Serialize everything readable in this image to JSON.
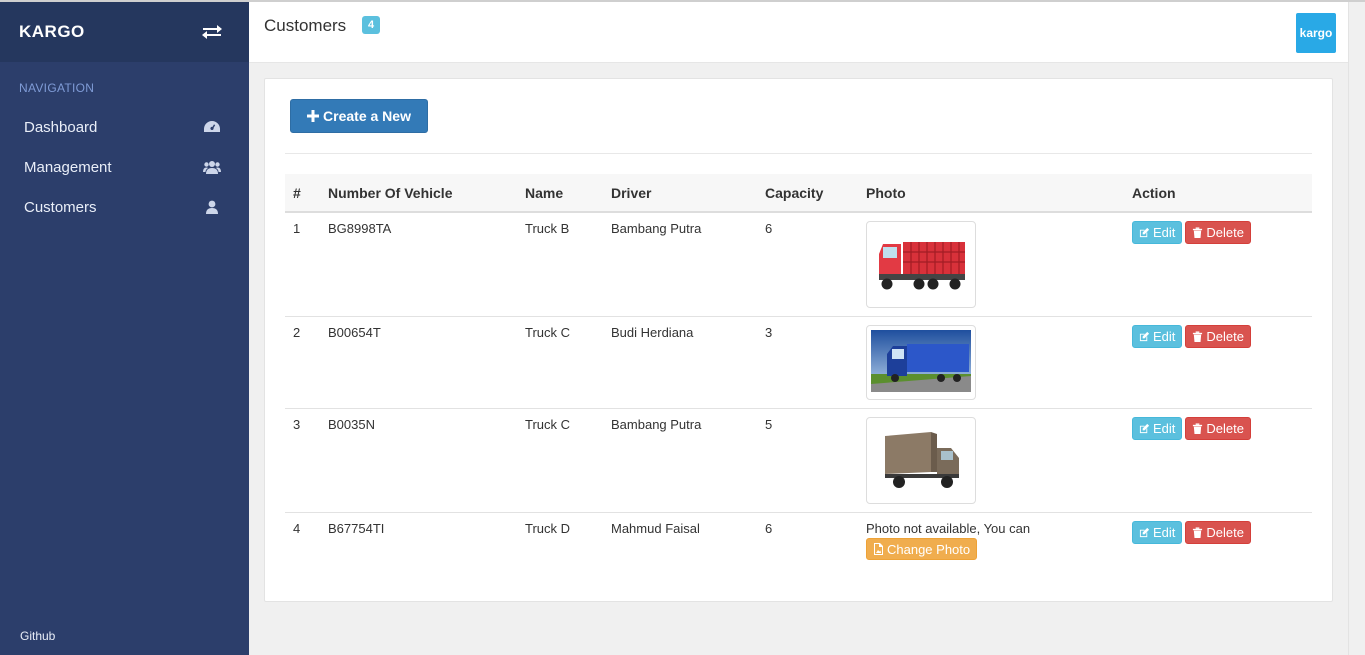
{
  "sidebar": {
    "brand": "KARGO",
    "nav_header": "NAVIGATION",
    "items": [
      {
        "label": "Dashboard",
        "icon": "dashboard-icon"
      },
      {
        "label": "Management",
        "icon": "users-icon"
      },
      {
        "label": "Customers",
        "icon": "user-icon"
      }
    ],
    "footer": "Github"
  },
  "header": {
    "title": "Customers",
    "badge": "4",
    "logo": "kargo"
  },
  "main": {
    "create_button": "Create a New",
    "columns": [
      "#",
      "Number Of Vehicle",
      "Name",
      "Driver",
      "Capacity",
      "Photo",
      "Action"
    ],
    "rows": [
      {
        "no": "1",
        "vehicle": "BG8998TA",
        "name": "Truck B",
        "driver": "Bambang Putra",
        "capacity": "6",
        "photo": "red-truck-photo"
      },
      {
        "no": "2",
        "vehicle": "B00654T",
        "name": "Truck C",
        "driver": "Budi Herdiana",
        "capacity": "3",
        "photo": "blue-truck-photo"
      },
      {
        "no": "3",
        "vehicle": "B0035N",
        "name": "Truck C",
        "driver": "Bambang Putra",
        "capacity": "5",
        "photo": "box-truck-photo"
      },
      {
        "no": "4",
        "vehicle": "B67754TI",
        "name": "Truck D",
        "driver": "Mahmud Faisal",
        "capacity": "6",
        "photo_missing_text": "Photo not available, You can",
        "change_photo_label": "Change Photo"
      }
    ],
    "edit_label": "Edit",
    "delete_label": "Delete"
  },
  "colors": {
    "sidebar": "#2c3e6b",
    "primary": "#337ab7",
    "info": "#5bc0de",
    "danger": "#d9534f",
    "warning": "#f0ad4e"
  }
}
